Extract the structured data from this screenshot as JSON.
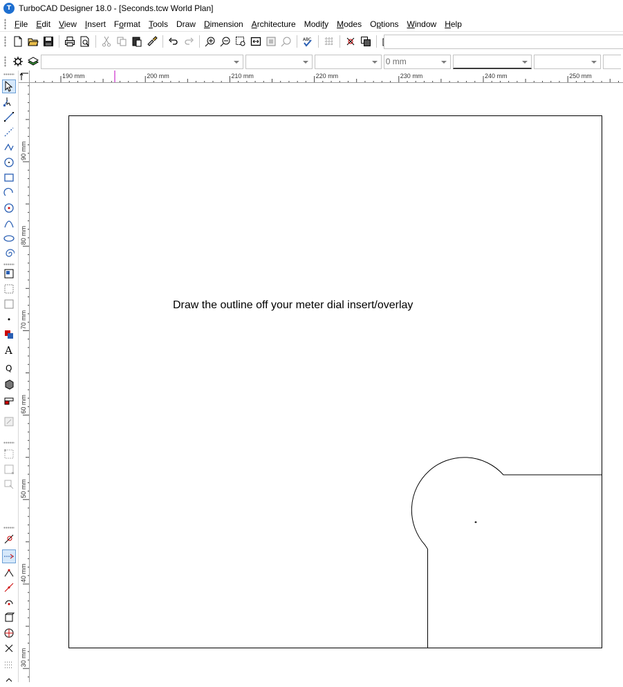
{
  "window": {
    "title": "TurboCAD Designer 18.0 - [Seconds.tcw World Plan]",
    "icon": "turbocad-app-icon"
  },
  "menu": [
    {
      "label": "File",
      "underline": "F"
    },
    {
      "label": "Edit",
      "underline": "E"
    },
    {
      "label": "View",
      "underline": "V"
    },
    {
      "label": "Insert",
      "underline": "I"
    },
    {
      "label": "Format",
      "underline": "o"
    },
    {
      "label": "Tools",
      "underline": "T"
    },
    {
      "label": "Draw",
      "underline": ""
    },
    {
      "label": "Dimension",
      "underline": "D"
    },
    {
      "label": "Architecture",
      "underline": "A"
    },
    {
      "label": "Modify",
      "underline": "f"
    },
    {
      "label": "Modes",
      "underline": "M"
    },
    {
      "label": "Options",
      "underline": "p"
    },
    {
      "label": "Window",
      "underline": "W"
    },
    {
      "label": "Help",
      "underline": "H"
    }
  ],
  "property_bar": {
    "width_value": "0 mm"
  },
  "ruler": {
    "horizontal_labels": [
      "190 mm",
      "200 mm",
      "210 mm",
      "220 mm",
      "230 mm",
      "240 mm",
      "250 mm"
    ],
    "vertical_labels": [
      "90 mm",
      "80 mm",
      "70 mm",
      "60 mm",
      "50 mm",
      "40 mm",
      "30 mm"
    ]
  },
  "drawing": {
    "annotation": "Draw the outline off your meter dial insert/overlay"
  }
}
